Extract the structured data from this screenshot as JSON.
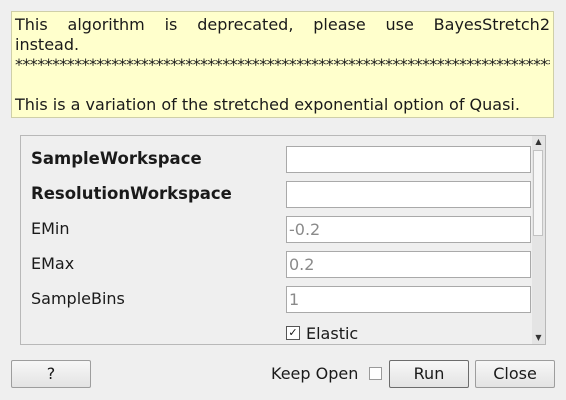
{
  "description": {
    "line1": "This algorithm is deprecated, please use BayesStretch2",
    "line2": "instead.",
    "line3": "*******************************************************************************",
    "line5": "This is a variation of the stretched exponential option of Quasi."
  },
  "properties": [
    {
      "label": "SampleWorkspace",
      "value": "",
      "placeholder": ""
    },
    {
      "label": "ResolutionWorkspace",
      "value": "",
      "placeholder": ""
    },
    {
      "label": "EMin",
      "value": "",
      "placeholder": "-0.2"
    },
    {
      "label": "EMax",
      "value": "",
      "placeholder": "0.2"
    },
    {
      "label": "SampleBins",
      "value": "",
      "placeholder": "1"
    }
  ],
  "elastic": {
    "label": "Elastic",
    "checked": true,
    "mark": "✓"
  },
  "scrollbar": {
    "up": "▲",
    "down": "▼"
  },
  "buttons": {
    "help": "?",
    "keep_open": "Keep Open",
    "keep_open_checked": false,
    "run": "Run",
    "close": "Close"
  }
}
